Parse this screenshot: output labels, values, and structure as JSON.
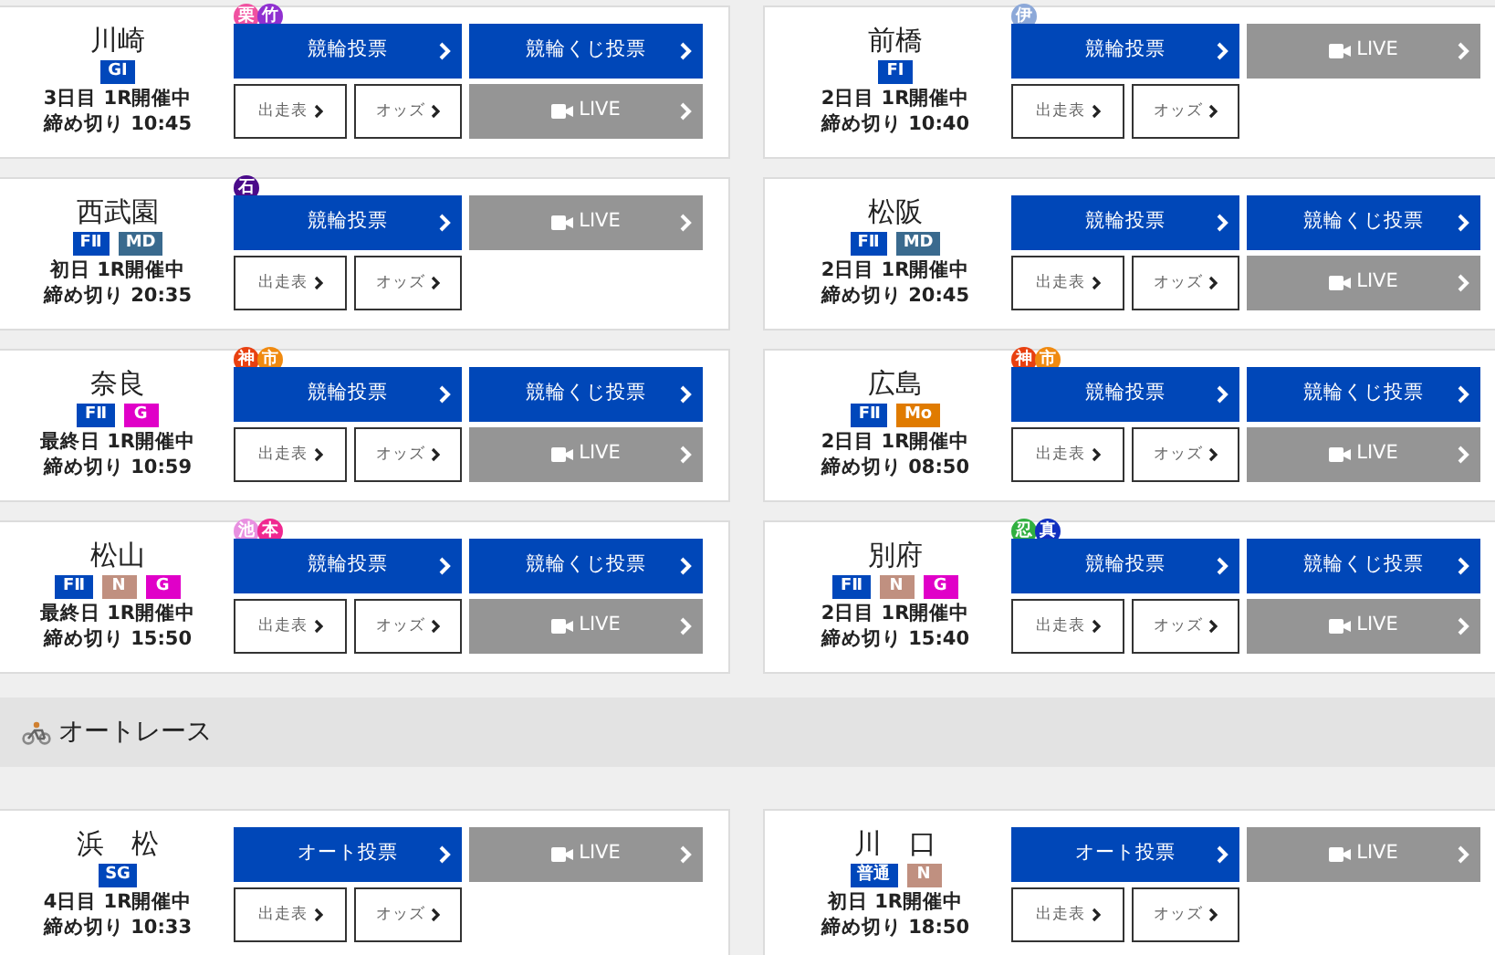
{
  "sections": [
    {
      "venues": [
        {
          "name": "川崎",
          "markers": [
            {
              "text": "栗",
              "color": "#f050a0"
            },
            {
              "text": "竹",
              "color": "#9030d0"
            }
          ],
          "grades": [
            {
              "text": "GI",
              "color": "#0047bb"
            }
          ],
          "day": "3日目 1R開催中",
          "deadline": "締め切り 10:45",
          "buttons": [
            {
              "kind": "bet",
              "label": "競輪投票"
            },
            {
              "kind": "bet",
              "label": "競輪くじ投票"
            },
            {
              "kind": "live",
              "label": "LIVE"
            }
          ],
          "links": [
            "出走表",
            "オッズ"
          ]
        },
        {
          "name": "前橋",
          "markers": [
            {
              "text": "伊",
              "color": "#8ca8d8"
            }
          ],
          "grades": [
            {
              "text": "FI",
              "color": "#0047bb"
            }
          ],
          "day": "2日目 1R開催中",
          "deadline": "締め切り 10:40",
          "buttons": [
            {
              "kind": "bet",
              "label": "競輪投票"
            },
            {
              "kind": "live",
              "label": "LIVE"
            }
          ],
          "links": [
            "出走表",
            "オッズ"
          ]
        },
        {
          "name": "西武園",
          "markers": [
            {
              "text": "石",
              "color": "#4a0a8a"
            }
          ],
          "grades": [
            {
              "text": "FⅡ",
              "color": "#0047bb"
            },
            {
              "text": "MD",
              "color": "#3a6a8e"
            }
          ],
          "day": "初日 1R開催中",
          "deadline": "締め切り 20:35",
          "buttons": [
            {
              "kind": "bet",
              "label": "競輪投票"
            },
            {
              "kind": "live",
              "label": "LIVE"
            }
          ],
          "links": [
            "出走表",
            "オッズ"
          ]
        },
        {
          "name": "松阪",
          "grades": [
            {
              "text": "FⅡ",
              "color": "#0047bb"
            },
            {
              "text": "MD",
              "color": "#3a6a8e"
            }
          ],
          "day": "2日目 1R開催中",
          "deadline": "締め切り 20:45",
          "buttons": [
            {
              "kind": "bet",
              "label": "競輪投票"
            },
            {
              "kind": "bet",
              "label": "競輪くじ投票"
            },
            {
              "kind": "live",
              "label": "LIVE"
            }
          ],
          "links": [
            "出走表",
            "オッズ"
          ]
        },
        {
          "name": "奈良",
          "markers": [
            {
              "text": "神",
              "color": "#e84010"
            },
            {
              "text": "市",
              "color": "#f08a10"
            }
          ],
          "grades": [
            {
              "text": "FⅡ",
              "color": "#0047bb"
            },
            {
              "text": "G",
              "color": "#e000c8"
            }
          ],
          "day": "最終日 1R開催中",
          "deadline": "締め切り 10:59",
          "buttons": [
            {
              "kind": "bet",
              "label": "競輪投票"
            },
            {
              "kind": "bet",
              "label": "競輪くじ投票"
            },
            {
              "kind": "live",
              "label": "LIVE"
            }
          ],
          "links": [
            "出走表",
            "オッズ"
          ]
        },
        {
          "name": "広島",
          "markers": [
            {
              "text": "神",
              "color": "#e84010"
            },
            {
              "text": "市",
              "color": "#f08a10"
            }
          ],
          "grades": [
            {
              "text": "FⅡ",
              "color": "#0047bb"
            },
            {
              "text": "Mo",
              "color": "#e07b00"
            }
          ],
          "day": "2日目 1R開催中",
          "deadline": "締め切り 08:50",
          "buttons": [
            {
              "kind": "bet",
              "label": "競輪投票"
            },
            {
              "kind": "bet",
              "label": "競輪くじ投票"
            },
            {
              "kind": "live",
              "label": "LIVE"
            }
          ],
          "links": [
            "出走表",
            "オッズ"
          ]
        },
        {
          "name": "松山",
          "markers": [
            {
              "text": "池",
              "color": "#e890e0"
            },
            {
              "text": "本",
              "color": "#f02890"
            }
          ],
          "grades": [
            {
              "text": "FⅡ",
              "color": "#0047bb"
            },
            {
              "text": "N",
              "color": "#c09080"
            },
            {
              "text": "G",
              "color": "#e000c8"
            }
          ],
          "day": "最終日 1R開催中",
          "deadline": "締め切り 15:50",
          "buttons": [
            {
              "kind": "bet",
              "label": "競輪投票"
            },
            {
              "kind": "bet",
              "label": "競輪くじ投票"
            },
            {
              "kind": "live",
              "label": "LIVE"
            }
          ],
          "links": [
            "出走表",
            "オッズ"
          ]
        },
        {
          "name": "別府",
          "markers": [
            {
              "text": "忍",
              "color": "#30b040"
            },
            {
              "text": "真",
              "color": "#1030c0"
            }
          ],
          "grades": [
            {
              "text": "FⅡ",
              "color": "#0047bb"
            },
            {
              "text": "N",
              "color": "#c09080"
            },
            {
              "text": "G",
              "color": "#e000c8"
            }
          ],
          "day": "2日目 1R開催中",
          "deadline": "締め切り 15:40",
          "buttons": [
            {
              "kind": "bet",
              "label": "競輪投票"
            },
            {
              "kind": "bet",
              "label": "競輪くじ投票"
            },
            {
              "kind": "live",
              "label": "LIVE"
            }
          ],
          "links": [
            "出走表",
            "オッズ"
          ]
        }
      ]
    },
    {
      "heading": "オートレース",
      "venues": [
        {
          "name": "浜　松",
          "grades": [
            {
              "text": "SG",
              "color": "#0047bb"
            }
          ],
          "day": "4日目 1R開催中",
          "deadline": "締め切り 10:33",
          "buttons": [
            {
              "kind": "bet",
              "label": "オート投票"
            },
            {
              "kind": "live",
              "label": "LIVE"
            }
          ],
          "links": [
            "出走表",
            "オッズ"
          ]
        },
        {
          "name": "川　口",
          "grades": [
            {
              "text": "普通",
              "color": "#0047bb"
            },
            {
              "text": "N",
              "color": "#c09080"
            }
          ],
          "day": "初日 1R開催中",
          "deadline": "締め切り 18:50",
          "buttons": [
            {
              "kind": "bet",
              "label": "オート投票"
            },
            {
              "kind": "live",
              "label": "LIVE"
            }
          ],
          "links": [
            "出走表",
            "オッズ"
          ]
        }
      ]
    }
  ]
}
